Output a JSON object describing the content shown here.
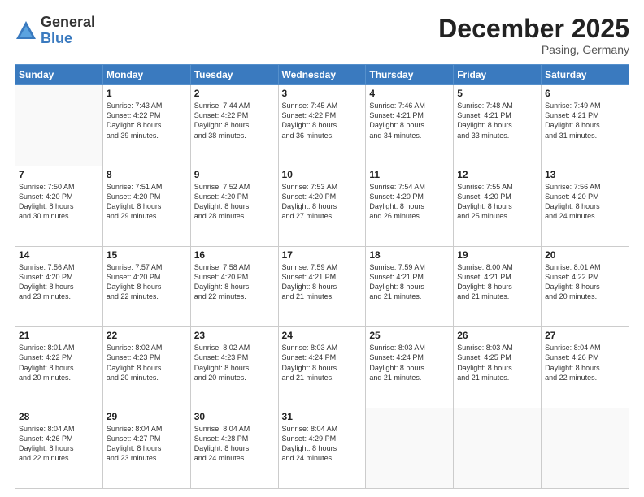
{
  "logo": {
    "general": "General",
    "blue": "Blue"
  },
  "title": "December 2025",
  "location": "Pasing, Germany",
  "days_header": [
    "Sunday",
    "Monday",
    "Tuesday",
    "Wednesday",
    "Thursday",
    "Friday",
    "Saturday"
  ],
  "weeks": [
    [
      {
        "num": "",
        "info": ""
      },
      {
        "num": "1",
        "info": "Sunrise: 7:43 AM\nSunset: 4:22 PM\nDaylight: 8 hours\nand 39 minutes."
      },
      {
        "num": "2",
        "info": "Sunrise: 7:44 AM\nSunset: 4:22 PM\nDaylight: 8 hours\nand 38 minutes."
      },
      {
        "num": "3",
        "info": "Sunrise: 7:45 AM\nSunset: 4:22 PM\nDaylight: 8 hours\nand 36 minutes."
      },
      {
        "num": "4",
        "info": "Sunrise: 7:46 AM\nSunset: 4:21 PM\nDaylight: 8 hours\nand 34 minutes."
      },
      {
        "num": "5",
        "info": "Sunrise: 7:48 AM\nSunset: 4:21 PM\nDaylight: 8 hours\nand 33 minutes."
      },
      {
        "num": "6",
        "info": "Sunrise: 7:49 AM\nSunset: 4:21 PM\nDaylight: 8 hours\nand 31 minutes."
      }
    ],
    [
      {
        "num": "7",
        "info": "Sunrise: 7:50 AM\nSunset: 4:20 PM\nDaylight: 8 hours\nand 30 minutes."
      },
      {
        "num": "8",
        "info": "Sunrise: 7:51 AM\nSunset: 4:20 PM\nDaylight: 8 hours\nand 29 minutes."
      },
      {
        "num": "9",
        "info": "Sunrise: 7:52 AM\nSunset: 4:20 PM\nDaylight: 8 hours\nand 28 minutes."
      },
      {
        "num": "10",
        "info": "Sunrise: 7:53 AM\nSunset: 4:20 PM\nDaylight: 8 hours\nand 27 minutes."
      },
      {
        "num": "11",
        "info": "Sunrise: 7:54 AM\nSunset: 4:20 PM\nDaylight: 8 hours\nand 26 minutes."
      },
      {
        "num": "12",
        "info": "Sunrise: 7:55 AM\nSunset: 4:20 PM\nDaylight: 8 hours\nand 25 minutes."
      },
      {
        "num": "13",
        "info": "Sunrise: 7:56 AM\nSunset: 4:20 PM\nDaylight: 8 hours\nand 24 minutes."
      }
    ],
    [
      {
        "num": "14",
        "info": "Sunrise: 7:56 AM\nSunset: 4:20 PM\nDaylight: 8 hours\nand 23 minutes."
      },
      {
        "num": "15",
        "info": "Sunrise: 7:57 AM\nSunset: 4:20 PM\nDaylight: 8 hours\nand 22 minutes."
      },
      {
        "num": "16",
        "info": "Sunrise: 7:58 AM\nSunset: 4:20 PM\nDaylight: 8 hours\nand 22 minutes."
      },
      {
        "num": "17",
        "info": "Sunrise: 7:59 AM\nSunset: 4:21 PM\nDaylight: 8 hours\nand 21 minutes."
      },
      {
        "num": "18",
        "info": "Sunrise: 7:59 AM\nSunset: 4:21 PM\nDaylight: 8 hours\nand 21 minutes."
      },
      {
        "num": "19",
        "info": "Sunrise: 8:00 AM\nSunset: 4:21 PM\nDaylight: 8 hours\nand 21 minutes."
      },
      {
        "num": "20",
        "info": "Sunrise: 8:01 AM\nSunset: 4:22 PM\nDaylight: 8 hours\nand 20 minutes."
      }
    ],
    [
      {
        "num": "21",
        "info": "Sunrise: 8:01 AM\nSunset: 4:22 PM\nDaylight: 8 hours\nand 20 minutes."
      },
      {
        "num": "22",
        "info": "Sunrise: 8:02 AM\nSunset: 4:23 PM\nDaylight: 8 hours\nand 20 minutes."
      },
      {
        "num": "23",
        "info": "Sunrise: 8:02 AM\nSunset: 4:23 PM\nDaylight: 8 hours\nand 20 minutes."
      },
      {
        "num": "24",
        "info": "Sunrise: 8:03 AM\nSunset: 4:24 PM\nDaylight: 8 hours\nand 21 minutes."
      },
      {
        "num": "25",
        "info": "Sunrise: 8:03 AM\nSunset: 4:24 PM\nDaylight: 8 hours\nand 21 minutes."
      },
      {
        "num": "26",
        "info": "Sunrise: 8:03 AM\nSunset: 4:25 PM\nDaylight: 8 hours\nand 21 minutes."
      },
      {
        "num": "27",
        "info": "Sunrise: 8:04 AM\nSunset: 4:26 PM\nDaylight: 8 hours\nand 22 minutes."
      }
    ],
    [
      {
        "num": "28",
        "info": "Sunrise: 8:04 AM\nSunset: 4:26 PM\nDaylight: 8 hours\nand 22 minutes."
      },
      {
        "num": "29",
        "info": "Sunrise: 8:04 AM\nSunset: 4:27 PM\nDaylight: 8 hours\nand 23 minutes."
      },
      {
        "num": "30",
        "info": "Sunrise: 8:04 AM\nSunset: 4:28 PM\nDaylight: 8 hours\nand 24 minutes."
      },
      {
        "num": "31",
        "info": "Sunrise: 8:04 AM\nSunset: 4:29 PM\nDaylight: 8 hours\nand 24 minutes."
      },
      {
        "num": "",
        "info": ""
      },
      {
        "num": "",
        "info": ""
      },
      {
        "num": "",
        "info": ""
      }
    ]
  ]
}
